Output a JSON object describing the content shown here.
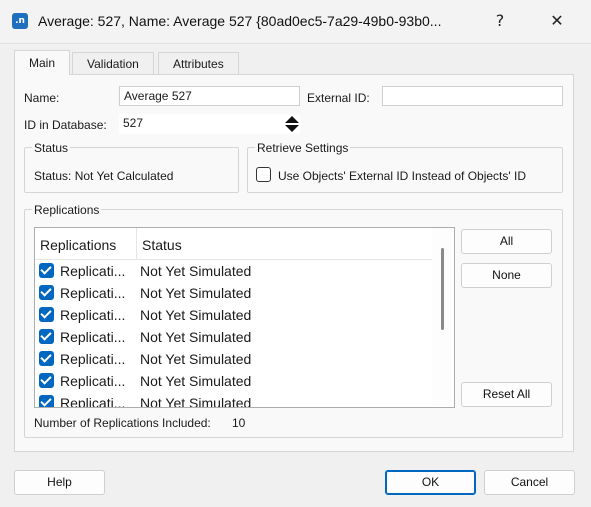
{
  "window": {
    "title": "Average: 527, Name: Average 527  {80ad0ec5-7a29-49b0-93b0...",
    "app_icon_text": ".n",
    "help_glyph": "?",
    "close_glyph": "✕"
  },
  "tabs": [
    {
      "label": "Main",
      "active": true
    },
    {
      "label": "Validation",
      "active": false
    },
    {
      "label": "Attributes",
      "active": false
    }
  ],
  "form": {
    "name_label": "Name:",
    "name_value": "Average 527",
    "external_id_label": "External ID:",
    "external_id_value": "",
    "id_label": "ID in Database:",
    "id_value": "527"
  },
  "status_group": {
    "title": "Status",
    "text": "Status: Not Yet Calculated"
  },
  "retrieve_group": {
    "title": "Retrieve Settings",
    "checkbox_label": "Use Objects' External ID Instead of Objects' ID",
    "checked": false
  },
  "replications_group": {
    "title": "Replications",
    "columns": [
      "Replications",
      "Status"
    ],
    "rows": [
      {
        "name": "Replicati...",
        "status": "Not Yet Simulated",
        "checked": true
      },
      {
        "name": "Replicati...",
        "status": "Not Yet Simulated",
        "checked": true
      },
      {
        "name": "Replicati...",
        "status": "Not Yet Simulated",
        "checked": true
      },
      {
        "name": "Replicati...",
        "status": "Not Yet Simulated",
        "checked": true
      },
      {
        "name": "Replicati...",
        "status": "Not Yet Simulated",
        "checked": true
      },
      {
        "name": "Replicati...",
        "status": "Not Yet Simulated",
        "checked": true
      },
      {
        "name": "Replicati...",
        "status": "Not Yet Simulated",
        "checked": true
      }
    ],
    "all_button": "All",
    "none_button": "None",
    "reset_button": "Reset All",
    "count_label": "Number of Replications Included:",
    "count_value": "10"
  },
  "footer": {
    "help_button": "Help",
    "ok_button": "OK",
    "cancel_button": "Cancel"
  },
  "colors": {
    "accent": "#0067c0",
    "window_bg": "#f0f0f0",
    "panel_bg": "#f9f9f9"
  }
}
